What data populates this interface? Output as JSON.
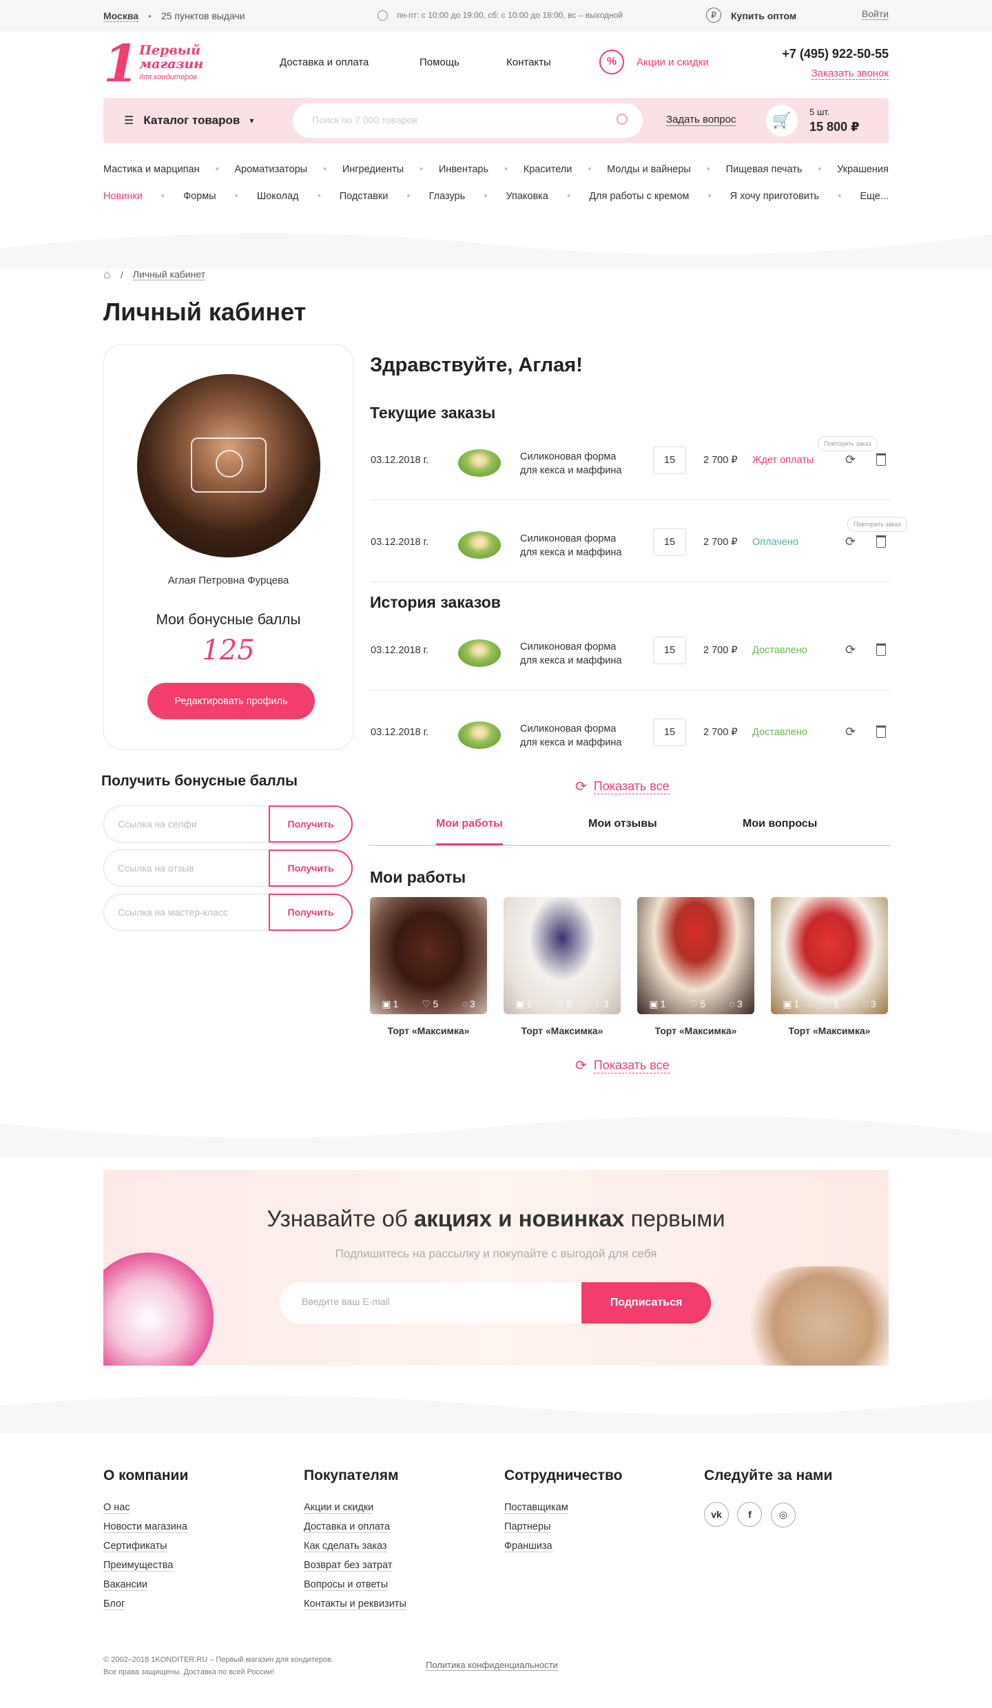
{
  "topbar": {
    "city": "Москва",
    "points": "25 пунктов выдачи",
    "hours": "пн-пт: с 10:00 до 19:00, сб: с 10:00 до 18:00, вс – выходной",
    "wholesale": "Купить оптом",
    "login": "Войти"
  },
  "logo": {
    "number": "1",
    "line1": "Первый",
    "line2": "магазин",
    "line3": "для кондитеров"
  },
  "nav": {
    "delivery": "Доставка и оплата",
    "help": "Помощь",
    "contacts": "Контакты",
    "promo": "Акции и скидки"
  },
  "contact": {
    "phone": "+7 (495) 922-50-55",
    "callback": "Заказать звонок"
  },
  "searchbar": {
    "catalog": "Каталог товаров",
    "placeholder": "Поиск по 7 000 товаров",
    "ask": "Задать вопрос",
    "cart_count": "5 шт.",
    "cart_total": "15 800 ₽"
  },
  "categories_row1": [
    "Мастика и марципан",
    "Ароматизаторы",
    "Ингредиенты",
    "Инвентарь",
    "Красители",
    "Молды и вайнеры",
    "Пищевая печать",
    "Украшения"
  ],
  "categories_row2": [
    "Новинки",
    "Формы",
    "Шоколад",
    "Подставки",
    "Глазурь",
    "Упаковка",
    "Для работы с кремом",
    "Я хочу приготовить",
    "Еще..."
  ],
  "breadcrumb": {
    "current": "Личный кабинет"
  },
  "page_title": "Личный кабинет",
  "profile": {
    "name": "Аглая Петровна Фурцева",
    "bonus_title": "Мои бонусные баллы",
    "bonus_value": "125",
    "edit": "Редактировать профиль"
  },
  "greeting": "Здравствуйте, Аглая!",
  "current_orders_title": "Текущие заказы",
  "history_title": "История заказов",
  "repeat_tip": "Повторить заказ",
  "orders": [
    {
      "date": "03.12.2018 г.",
      "name1": "Силиконовая форма",
      "name2": "для кекса и маффина",
      "qty": "15",
      "price": "2 700 ₽",
      "status": "Ждет оплаты"
    },
    {
      "date": "03.12.2018 г.",
      "name1": "Силиконовая форма",
      "name2": "для кекса и маффина",
      "qty": "15",
      "price": "2 700 ₽",
      "status": "Оплачено"
    },
    {
      "date": "03.12.2018 г.",
      "name1": "Силиконовая форма",
      "name2": "для кекса и маффина",
      "qty": "15",
      "price": "2 700 ₽",
      "status": "Доставлено"
    },
    {
      "date": "03.12.2018 г.",
      "name1": "Силиконовая форма",
      "name2": "для кекса и маффина",
      "qty": "15",
      "price": "2 700 ₽",
      "status": "Доставлено"
    }
  ],
  "show_all": "Показать все",
  "bonus_get": {
    "title": "Получить бонусные баллы",
    "button": "Получить",
    "inputs": [
      "Ссылка на селфи",
      "Ссылка на отзыв",
      "Ссылка на мастер-класс"
    ]
  },
  "tabs": [
    "Мои работы",
    "Мои отзывы",
    "Мои вопросы"
  ],
  "works_title": "Мои работы",
  "works": [
    {
      "caption": "Торт «Максимка»",
      "photos": "1",
      "likes": "5",
      "comments": "3"
    },
    {
      "caption": "Торт «Максимка»",
      "photos": "1",
      "likes": "5",
      "comments": "3"
    },
    {
      "caption": "Торт «Максимка»",
      "photos": "1",
      "likes": "5",
      "comments": "3"
    },
    {
      "caption": "Торт «Максимка»",
      "photos": "1",
      "likes": "5",
      "comments": "3"
    }
  ],
  "subscribe": {
    "title_pre": "Узнавайте об ",
    "title_bold": "акциях и новинках",
    "title_post": " первыми",
    "subtitle": "Подпишитесь на рассылку и покупайте с выгодой для себя",
    "placeholder": "Введите ваш E-mail",
    "button": "Подписаться"
  },
  "footer": {
    "company": {
      "title": "О компании",
      "links": [
        "О нас",
        "Новости магазина",
        "Сертификаты",
        "Преимущества",
        "Вакансии",
        "Блог"
      ]
    },
    "buyers": {
      "title": "Покупателям",
      "links": [
        "Акции и скидки",
        "Доставка и оплата",
        "Как сделать заказ",
        "Возврат без затрат",
        "Вопросы и ответы",
        "Контакты и реквизиты"
      ]
    },
    "partners": {
      "title": "Сотрудничество",
      "links": [
        "Поставщикам",
        "Партнеры",
        "Франшиза"
      ]
    },
    "follow": {
      "title": "Следуйте за нами",
      "vk": "vk",
      "fb": "f",
      "ig": "◎"
    },
    "copyright1": "© 2002–2018 1KONDITER.RU – Первый магазин для кондитеров.",
    "copyright2": "Все права защищены. Доставка по всей России!",
    "privacy": "Политика конфиденциальности"
  },
  "colors": {
    "accent": "#f23d6d",
    "paid": "#6cb84a",
    "pinkBg": "#fbe1e6"
  }
}
